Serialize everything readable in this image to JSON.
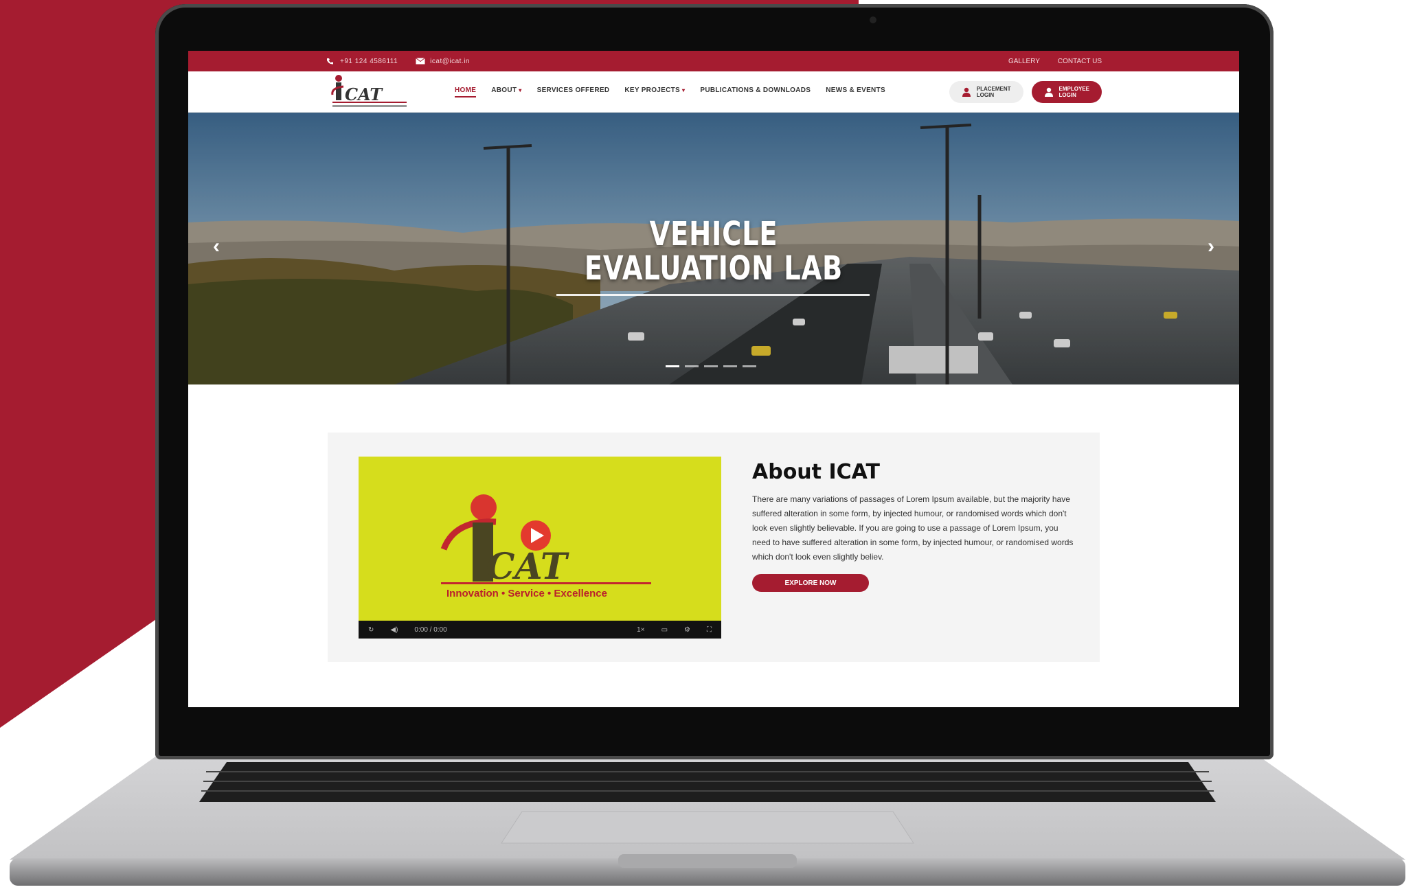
{
  "topbar": {
    "phone": "+91 124 4586111",
    "email": "icat@icat.in",
    "links": [
      "GALLERY",
      "CONTACT US"
    ]
  },
  "nav": {
    "logo_text": "ICAT",
    "logo_tagline": "INNOVATION • SERVICE • EXCELLENCE",
    "menu": [
      {
        "label": "HOME",
        "active": true,
        "caret": false
      },
      {
        "label": "ABOUT",
        "active": false,
        "caret": true
      },
      {
        "label": "SERVICES OFFERED",
        "active": false,
        "caret": false
      },
      {
        "label": "KEY PROJECTS",
        "active": false,
        "caret": true
      },
      {
        "label": "PUBLICATIONS & DOWNLOADS",
        "active": false,
        "caret": false
      },
      {
        "label": "NEWS & EVENTS",
        "active": false,
        "caret": false
      }
    ],
    "login_light": {
      "line1": "PLACEMENT",
      "line2": "LOGIN"
    },
    "login_dark": {
      "line1": "EMPLOYEE",
      "line2": "LOGIN"
    }
  },
  "hero": {
    "title_line1": "VEHICLE",
    "title_line2": "EVALUATION LAB",
    "prev_glyph": "‹",
    "next_glyph": "›",
    "slides": 5,
    "active_slide": 1
  },
  "about": {
    "title": "About ICAT",
    "body": "There are many variations of passages of Lorem Ipsum available, but the majority have suffered alteration in some form, by injected humour, or randomised words which don't look even slightly believable. If you are going to use a passage of Lorem Ipsum, you need to have suffered alteration in some form, by injected humour, or randomised words which don't look even slightly believ.",
    "button": "EXPLORE NOW",
    "video": {
      "logo_text": "ICAT",
      "tagline_parts": [
        "Innovation",
        "Service",
        "Excellence"
      ],
      "time": "0:00 / 0:00"
    }
  },
  "colors": {
    "brand_red": "#a51c30",
    "video_bg": "#d6dd1c"
  }
}
